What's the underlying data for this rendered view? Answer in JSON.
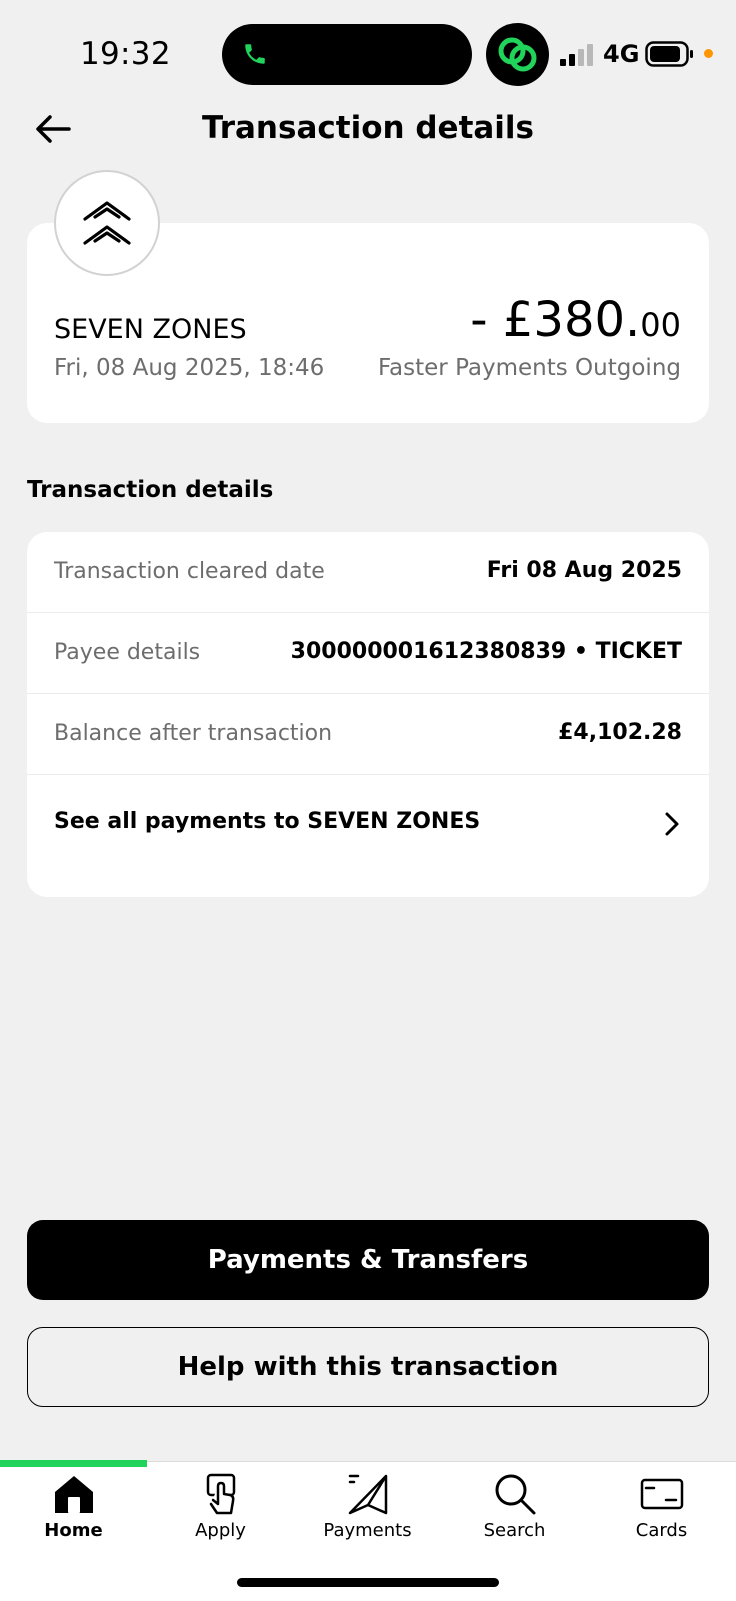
{
  "status_bar": {
    "time": "19:32",
    "network": "4G",
    "icons": [
      "phone-icon",
      "app-link-icon",
      "signal-icon",
      "battery-icon"
    ]
  },
  "header": {
    "title": "Transaction details",
    "back_icon": "arrow-left-icon"
  },
  "summary": {
    "merchant_name": "SEVEN ZONES",
    "datetime": "Fri, 08 Aug 2025, 18:46",
    "amount_main": "- £380.",
    "amount_pence": "00",
    "type": "Faster Payments Outgoing",
    "logo_icon": "double-chevron-up-icon"
  },
  "details": {
    "heading": "Transaction details",
    "rows": [
      {
        "label": "Transaction cleared date",
        "value": "Fri 08 Aug 2025"
      },
      {
        "label": "Payee details",
        "value": "300000001612380839 • TICKET"
      },
      {
        "label": "Balance after transaction",
        "value": "£4,102.28"
      }
    ],
    "see_all_label": "See all payments to SEVEN ZONES"
  },
  "buttons": {
    "primary": "Payments & Transfers",
    "secondary": "Help with this transaction"
  },
  "nav": {
    "items": [
      {
        "label": "Home",
        "icon": "home-icon",
        "active": true
      },
      {
        "label": "Apply",
        "icon": "apply-icon",
        "active": false
      },
      {
        "label": "Payments",
        "icon": "payments-icon",
        "active": false
      },
      {
        "label": "Search",
        "icon": "search-icon",
        "active": false
      },
      {
        "label": "Cards",
        "icon": "card-icon",
        "active": false
      }
    ]
  },
  "colors": {
    "accent_green": "#21d35b",
    "background": "#f0f0f0",
    "card": "#ffffff",
    "muted_text": "#6d6d6d"
  }
}
